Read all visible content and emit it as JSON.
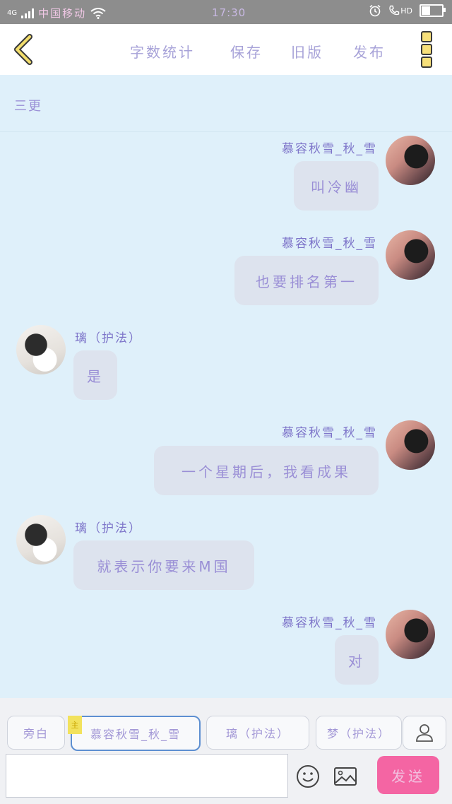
{
  "status_bar": {
    "network": "4G",
    "carrier": "中国移动",
    "time": "17:30",
    "hd": "HD"
  },
  "header": {
    "menu": [
      "字数统计",
      "保存",
      "旧版",
      "发布"
    ]
  },
  "chapter": {
    "title": "三更"
  },
  "messages": [
    {
      "side": "right",
      "name": "慕容秋雪_秋_雪",
      "text": "叫冷幽"
    },
    {
      "side": "right",
      "name": "慕容秋雪_秋_雪",
      "text": "也要排名第一"
    },
    {
      "side": "left",
      "name": "璃（护法）",
      "text": "是"
    },
    {
      "side": "right",
      "name": "慕容秋雪_秋_雪",
      "text": "一个星期后，我看成果"
    },
    {
      "side": "left",
      "name": "璃（护法）",
      "text": "就表示你要来M国"
    },
    {
      "side": "right",
      "name": "慕容秋雪_秋_雪",
      "text": "对"
    }
  ],
  "composer": {
    "roles": [
      "旁白",
      "慕容秋雪_秋_雪",
      "璃（护法）",
      "梦（护法）"
    ],
    "selected_role_tag": "主",
    "input_value": "",
    "send_label": "发送"
  },
  "colors": {
    "background": "#dff0fa",
    "accent_pink": "#f465a3",
    "text_purple": "#9a8fd6"
  },
  "icons": [
    "back-chevron-icon",
    "more-vertical-icon",
    "user-icon",
    "emoji-icon",
    "image-icon",
    "signal-icon",
    "wifi-icon",
    "alarm-icon",
    "phone-icon",
    "battery-icon"
  ]
}
